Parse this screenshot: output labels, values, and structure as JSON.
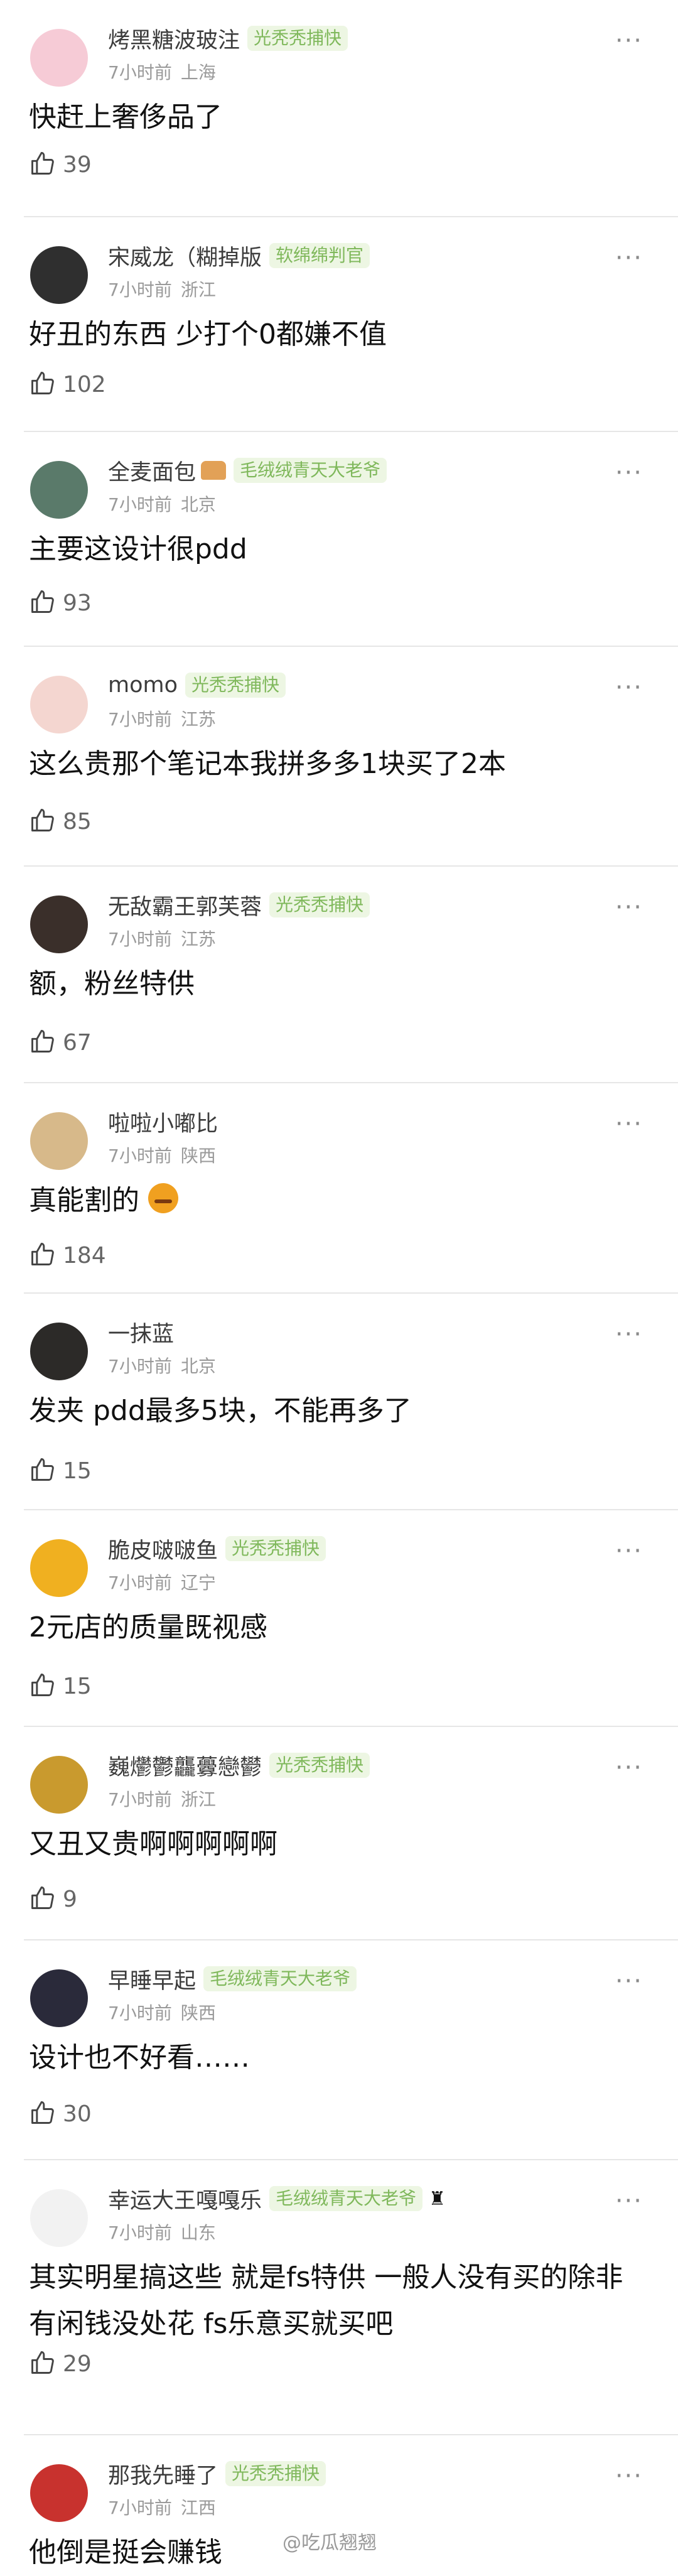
{
  "comments": [
    {
      "name": "烤黑糖波玻注",
      "badge": "光秃秃捕快",
      "time": "7小时前",
      "location": "上海",
      "text": "快赶上奢侈品了",
      "likes": "39",
      "avatar_color": "#f6cbd6"
    },
    {
      "name": "宋威龙（糊掉版",
      "badge": "软绵绵判官",
      "time": "7小时前",
      "location": "浙江",
      "text": "好丑的东西 少打个0都嫌不值",
      "likes": "102",
      "avatar_color": "#2f2f2f"
    },
    {
      "name": "全麦面包",
      "badge": "毛绒绒青天大老爷",
      "time": "7小时前",
      "location": "北京",
      "text": "主要这设计很pdd",
      "likes": "93",
      "avatar_color": "#5a7a6a"
    },
    {
      "name": "momo",
      "badge": "光秃秃捕快",
      "time": "7小时前",
      "location": "江苏",
      "text": "这么贵那个笔记本我拼多多1块买了2本",
      "likes": "85",
      "avatar_color": "#f4d6d0"
    },
    {
      "name": "无敌霸王郭芙蓉",
      "badge": "光秃秃捕快",
      "time": "7小时前",
      "location": "江苏",
      "text": "额，粉丝特供",
      "likes": "67",
      "avatar_color": "#3a2f2a"
    },
    {
      "name": "啦啦小嘟比",
      "badge": "",
      "time": "7小时前",
      "location": "陕西",
      "text": "真能割的",
      "likes": "184",
      "avatar_color": "#d7b98a"
    },
    {
      "name": "一抹蓝",
      "badge": "",
      "time": "7小时前",
      "location": "北京",
      "text": "发夹 pdd最多5块，不能再多了",
      "likes": "15",
      "avatar_color": "#2c2a28"
    },
    {
      "name": "脆皮啵啵鱼",
      "badge": "光秃秃捕快",
      "time": "7小时前",
      "location": "辽宁",
      "text": "2元店的质量既视感",
      "likes": "15",
      "avatar_color": "#f0b020"
    },
    {
      "name": "巍爩鬱龘虋戀鬰",
      "badge": "光秃秃捕快",
      "time": "7小时前",
      "location": "浙江",
      "text": "又丑又贵啊啊啊啊啊",
      "likes": "9",
      "avatar_color": "#c99a2e"
    },
    {
      "name": "早睡早起",
      "badge": "毛绒绒青天大老爷",
      "time": "7小时前",
      "location": "陕西",
      "text": "设计也不好看……",
      "likes": "30",
      "avatar_color": "#2a2a3a"
    },
    {
      "name": "幸运大王嘎嘎乐",
      "badge": "毛绒绒青天大老爷",
      "time": "7小时前",
      "location": "山东",
      "text": "其实明星搞这些  就是fs特供  一般人没有买的除非有闲钱没处花  fs乐意买就买吧",
      "likes": "29",
      "avatar_color": "#f2f2f2"
    },
    {
      "name": "那我先睡了",
      "badge": "光秃秃捕快",
      "time": "7小时前",
      "location": "江西",
      "text": "他倒是挺会赚钱",
      "likes": "",
      "avatar_color": "#c8322e"
    }
  ],
  "watermark": "@吃瓜翘翘"
}
